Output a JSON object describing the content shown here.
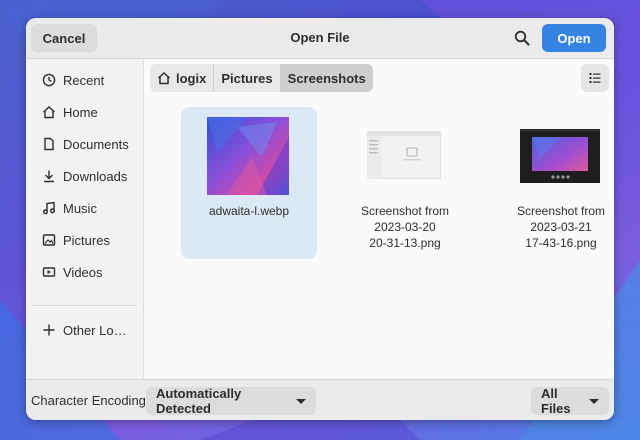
{
  "header": {
    "cancel_label": "Cancel",
    "title": "Open File",
    "open_label": "Open",
    "search_icon": "search-icon"
  },
  "sidebar": {
    "items": [
      {
        "label": "Recent",
        "icon": "clock-icon"
      },
      {
        "label": "Home",
        "icon": "home-icon"
      },
      {
        "label": "Documents",
        "icon": "document-icon"
      },
      {
        "label": "Downloads",
        "icon": "download-icon"
      },
      {
        "label": "Music",
        "icon": "music-icon"
      },
      {
        "label": "Pictures",
        "icon": "picture-icon"
      },
      {
        "label": "Videos",
        "icon": "video-icon"
      },
      {
        "label": "Other Lo…",
        "icon": "plus-icon"
      }
    ]
  },
  "pathbar": {
    "crumbs": [
      "logix",
      "Pictures",
      "Screenshots"
    ]
  },
  "files": [
    {
      "name": "adwaita-l.webp",
      "selected": true
    },
    {
      "name_lines": [
        "Screenshot from",
        "2023-03-20",
        "20-31-13.png"
      ]
    },
    {
      "name_lines": [
        "Screenshot from",
        "2023-03-21",
        "17-43-16.png"
      ]
    }
  ],
  "footer": {
    "encoding_label": "Character Encoding:",
    "encoding_value": "Automatically Detected",
    "filter_value": "All Files"
  },
  "colors": {
    "accent": "#3584e4",
    "selection": "#dde8f7"
  }
}
